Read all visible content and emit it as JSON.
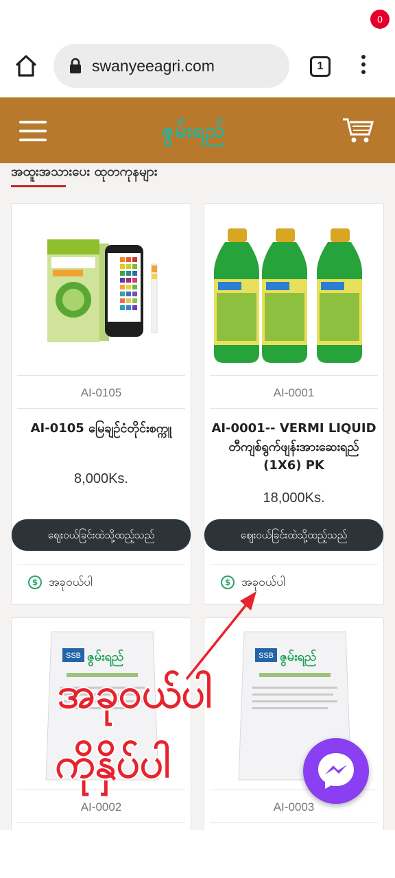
{
  "browser": {
    "url": "swanyeeagri.com",
    "tab_count": "1"
  },
  "header": {
    "logo_text": "ဇွမ်းရည်",
    "cart_count": "0",
    "background": "#b8792d",
    "logo_color": "#1fb5a3"
  },
  "section": {
    "title": "အထူးအသားပေး ထုတကုနများ"
  },
  "products": [
    {
      "sku": "AI-0105",
      "name": "AI-0105 မြေချဉ်ငံတိုင်းစက္ကူ",
      "price": "8,000Ks.",
      "add_to_cart": "ဈေးဝယ်ခြင်းထဲသို့ထည့်သည်",
      "buy_now": "အခုဝယ်ပါ"
    },
    {
      "sku": "AI-0001",
      "name": "AI-0001-- VERMI LIQUID တီကျစ်ရွက်ဖျန်းအားဆေးရည် (1X6) PK",
      "price": "18,000Ks.",
      "add_to_cart": "ဈေးဝယ်ခြင်းထဲသို့ထည့်သည်",
      "buy_now": "အခုဝယ်ပါ"
    },
    {
      "sku": "AI-0002",
      "bag_brand": "SSB ဇွမ်းရည်"
    },
    {
      "sku": "AI-0003",
      "bag_brand": "SSB ဇွမ်းရည်"
    }
  ],
  "overlay": {
    "line1": "အခုဝယ်ပါ",
    "line2": "ကိုနှိပ်ပါ",
    "color": "#e7232e"
  },
  "icons": {
    "home": "home-icon",
    "lock": "lock-icon",
    "menu": "kebab-menu-icon",
    "hamburger": "hamburger-icon",
    "cart": "cart-icon",
    "messenger": "messenger-icon"
  }
}
